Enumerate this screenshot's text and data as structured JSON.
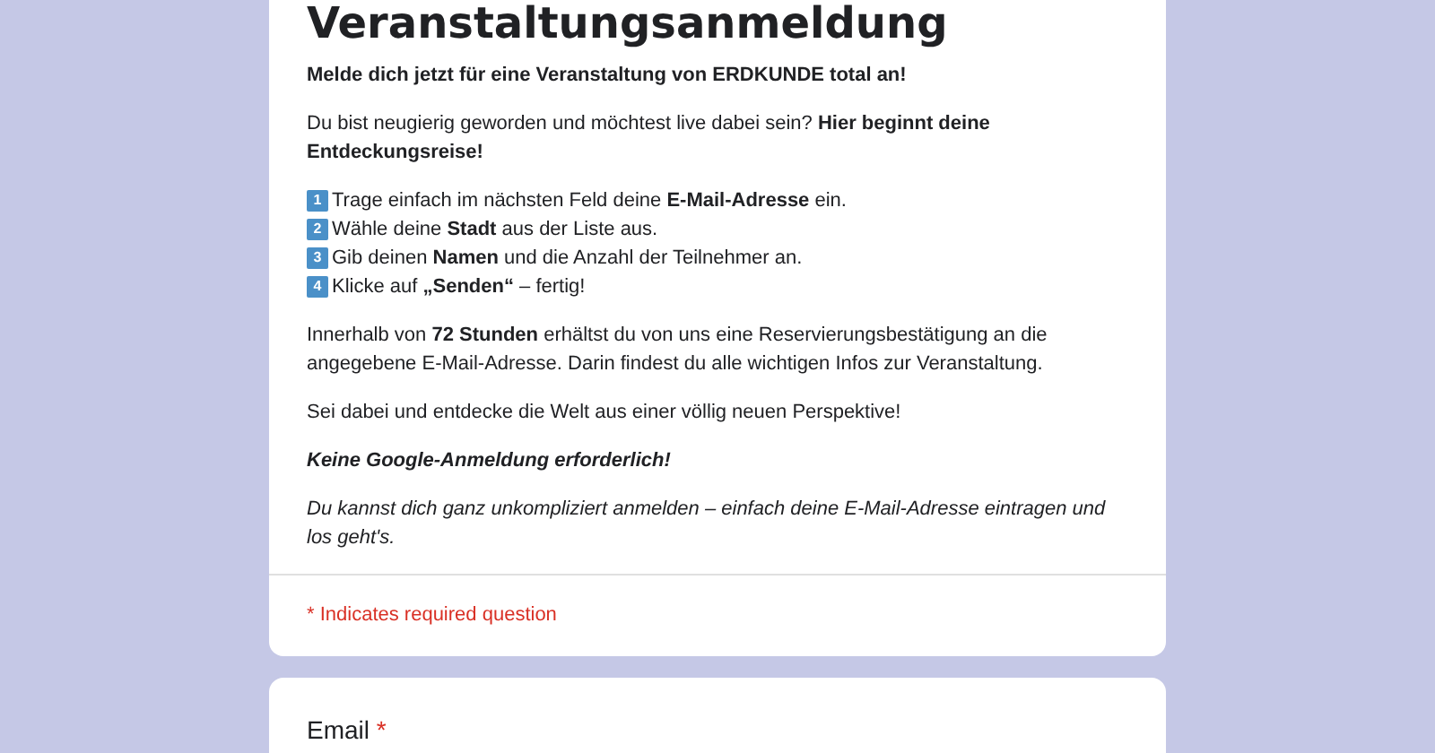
{
  "form": {
    "title": "Veranstaltungsanmeldung",
    "description": [
      {
        "kind": "bold",
        "text": "Melde dich jetzt für eine Veranstaltung von ERDKUNDE total an!"
      },
      {
        "kind": "plain",
        "text": "Du bist neugierig geworden und möchtest live dabei sein? **Hier beginnt deine Entdeckungsreise!**"
      },
      {
        "kind": "steps",
        "items": [
          {
            "marker": "1",
            "text": "Trage einfach im nächsten Feld deine **E-Mail-Adresse** ein."
          },
          {
            "marker": "2",
            "text": "Wähle deine **Stadt** aus der Liste aus."
          },
          {
            "marker": "3",
            "text": "Gib deinen **Namen** und die Anzahl der Teilnehmer an."
          },
          {
            "marker": "4",
            "text": "Klicke auf **„Senden“** – fertig!"
          }
        ]
      },
      {
        "kind": "plain",
        "text": "Innerhalb von **72 Stunden** erhältst du von uns eine Reservierungsbestätigung an die angegebene E-Mail-Adresse. Darin findest du alle wichtigen Infos zur Veranstaltung."
      },
      {
        "kind": "plain",
        "text": "Sei dabei und entdecke die Welt aus einer völlig neuen Perspektive!"
      },
      {
        "kind": "bold_italic",
        "text": "Keine Google-Anmeldung erforderlich!"
      },
      {
        "kind": "italic",
        "text": "Du kannst dich ganz unkompliziert anmelden – einfach deine E-Mail-Adresse eintragen und los geht's."
      }
    ],
    "required_note": "* Indicates required question"
  },
  "questions": [
    {
      "label": "Email",
      "required_mark": "*"
    }
  ]
}
